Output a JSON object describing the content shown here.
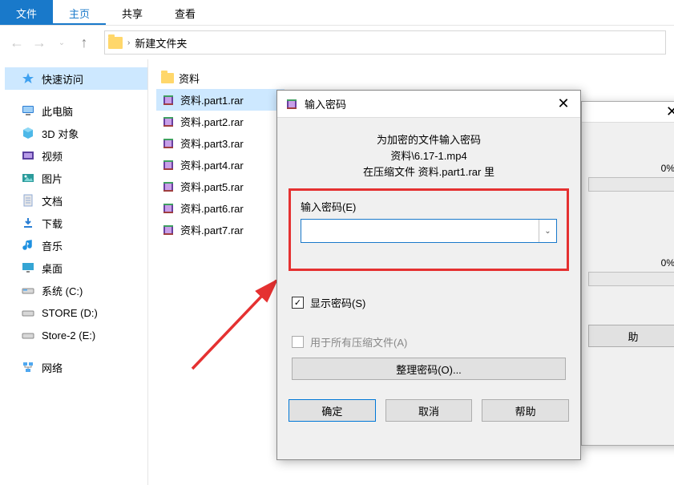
{
  "ribbon": {
    "file": "文件",
    "home": "主页",
    "share": "共享",
    "view": "查看"
  },
  "breadcrumb": {
    "folder": "新建文件夹"
  },
  "sidebar": {
    "quick_access": "快速访问",
    "this_pc": "此电脑",
    "objects3d": "3D 对象",
    "videos": "视频",
    "pictures": "图片",
    "documents": "文档",
    "downloads": "下载",
    "music": "音乐",
    "desktop": "桌面",
    "drive_c": "系统 (C:)",
    "drive_d": "STORE (D:)",
    "drive_e": "Store-2 (E:)",
    "network": "网络"
  },
  "files": {
    "folder1": "资料",
    "items": [
      "资料.part1.rar",
      "资料.part2.rar",
      "资料.part3.rar",
      "资料.part4.rar",
      "资料.part5.rar",
      "资料.part6.rar",
      "资料.part7.rar"
    ]
  },
  "bg_dialog": {
    "pct1": "0%",
    "pct2": "0%",
    "help": "助"
  },
  "pw_dialog": {
    "title": "输入密码",
    "msg_line1": "为加密的文件输入密码",
    "msg_line2": "资料\\6.17-1.mp4",
    "msg_line3": "在压缩文件 资料.part1.rar 里",
    "field_label": "输入密码(E)",
    "show_pw": "显示密码(S)",
    "all_archives": "用于所有压缩文件(A)",
    "manage": "整理密码(O)...",
    "ok": "确定",
    "cancel": "取消",
    "help": "帮助"
  }
}
